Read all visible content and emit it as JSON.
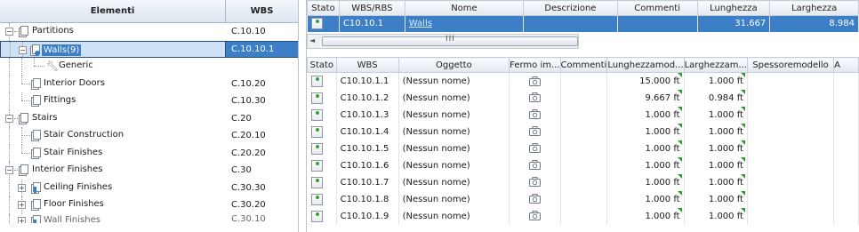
{
  "tree": {
    "header": {
      "col1": "Elementi",
      "col2": "WBS"
    },
    "rows": [
      {
        "label": "Partitions",
        "wbs": "C.10.10"
      },
      {
        "label": "Walls(9)",
        "wbs": "C.10.10.1"
      },
      {
        "label": "Generic",
        "wbs": ""
      },
      {
        "label": "Interior Doors",
        "wbs": "C.10.20"
      },
      {
        "label": "Fittings",
        "wbs": "C.10.30"
      },
      {
        "label": "Stairs",
        "wbs": "C.20"
      },
      {
        "label": "Stair Construction",
        "wbs": "C.20.10"
      },
      {
        "label": "Stair Finishes",
        "wbs": "C.20.20"
      },
      {
        "label": "Interior Finishes",
        "wbs": "C.30"
      },
      {
        "label": "Ceiling Finishes",
        "wbs": "C.30.30"
      },
      {
        "label": "Floor Finishes",
        "wbs": "C.30.20"
      },
      {
        "label": "Wall Finishes",
        "wbs": "C.30.10"
      }
    ]
  },
  "top_table": {
    "headers": [
      "Stato",
      "WBS/RBS",
      "Nome",
      "Descrizione",
      "Commenti",
      "Lunghezza",
      "Larghezza"
    ],
    "row": {
      "wbs": "C10.10.1",
      "nome": "Walls",
      "descrizione": "",
      "commenti": "",
      "lunghezza": "31.667",
      "larghezza": "8.984"
    }
  },
  "scrollbar": {
    "grip": "III"
  },
  "detail_table": {
    "headers": [
      "Stato",
      "WBS",
      "Oggetto",
      "Fermo im...",
      "Commenti",
      "Lunghezzamod...",
      "Larghezzam...",
      "Spessoremodello",
      "A"
    ],
    "rows": [
      {
        "wbs": "C10.10.1.1",
        "oggetto": "(Nessun nome)",
        "lung": "15.000 ft",
        "larg": "1.000 ft"
      },
      {
        "wbs": "C10.10.1.2",
        "oggetto": "(Nessun nome)",
        "lung": "9.667 ft",
        "larg": "0.984 ft"
      },
      {
        "wbs": "C10.10.1.3",
        "oggetto": "(Nessun nome)",
        "lung": "1.000 ft",
        "larg": "1.000 ft"
      },
      {
        "wbs": "C10.10.1.4",
        "oggetto": "(Nessun nome)",
        "lung": "1.000 ft",
        "larg": "1.000 ft"
      },
      {
        "wbs": "C10.10.1.5",
        "oggetto": "(Nessun nome)",
        "lung": "1.000 ft",
        "larg": "1.000 ft"
      },
      {
        "wbs": "C10.10.1.6",
        "oggetto": "(Nessun nome)",
        "lung": "1.000 ft",
        "larg": "1.000 ft"
      },
      {
        "wbs": "C10.10.1.7",
        "oggetto": "(Nessun nome)",
        "lung": "1.000 ft",
        "larg": "1.000 ft"
      },
      {
        "wbs": "C10.10.1.8",
        "oggetto": "(Nessun nome)",
        "lung": "1.000 ft",
        "larg": "1.000 ft"
      },
      {
        "wbs": "C10.10.1.9",
        "oggetto": "(Nessun nome)",
        "lung": "1.000 ft",
        "larg": "1.000 ft"
      }
    ]
  },
  "colors": {
    "selection": "#3d7fc6",
    "selection_light": "#cfe1f5",
    "status_green": "#2fa52f"
  }
}
